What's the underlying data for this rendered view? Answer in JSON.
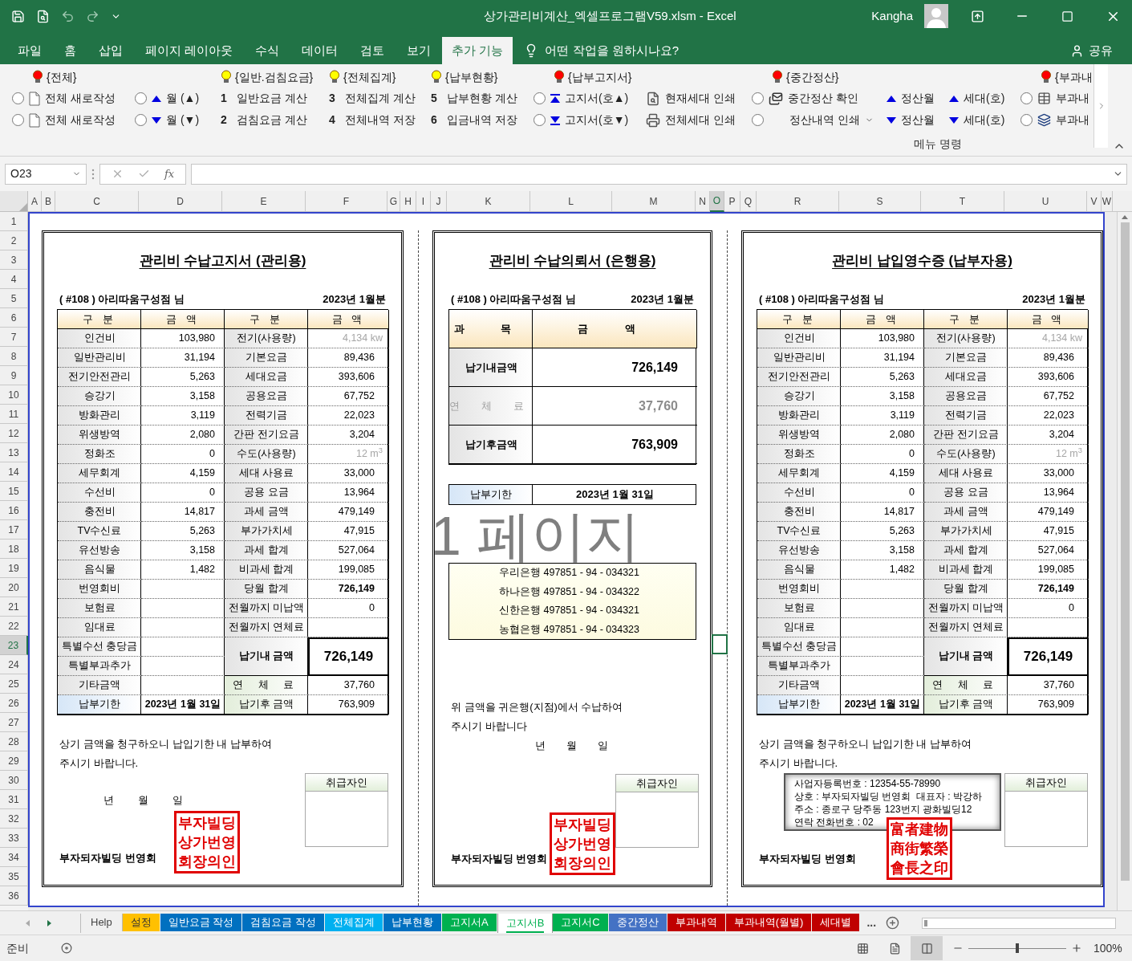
{
  "title_bar": {
    "title": "상가관리비계산_엑셀프로그램V59.xlsm  -  Excel",
    "user": "Kangha"
  },
  "ribbon_tabs": [
    {
      "label": "파일",
      "selected": false
    },
    {
      "label": "홈",
      "selected": false
    },
    {
      "label": "삽입",
      "selected": false
    },
    {
      "label": "페이지 레이아웃",
      "selected": false
    },
    {
      "label": "수식",
      "selected": false
    },
    {
      "label": "데이터",
      "selected": false
    },
    {
      "label": "검토",
      "selected": false
    },
    {
      "label": "보기",
      "selected": false
    },
    {
      "label": "추가 기능",
      "selected": true
    }
  ],
  "tell_me": "어떤 작업을 원하시나요?",
  "share": "공유",
  "ribbon": {
    "columns": [
      {
        "header": {
          "text": "{전체}",
          "color": "#ff0000"
        },
        "items": [
          {
            "selected": false,
            "kind": "doc",
            "text": "전체 새로작성"
          },
          {
            "selected": false,
            "kind": "doc",
            "text": "전체 새로작성"
          }
        ]
      },
      {
        "items": [
          {
            "selected": false,
            "kind": "up",
            "text": "월 (▲)"
          },
          {
            "selected": false,
            "kind": "down",
            "text": "월 (▼)"
          }
        ]
      },
      {
        "header": {
          "text": "{일반.검침요금}",
          "color": "#ffff00"
        },
        "items": [
          {
            "kind": "numbered",
            "number": "1",
            "text": "일반요금 계산"
          },
          {
            "kind": "numbered",
            "number": "2",
            "text": "검침요금 계산"
          }
        ]
      },
      {
        "header": {
          "text": "{전체집계}",
          "color": "#ffff00"
        },
        "items": [
          {
            "kind": "numbered",
            "number": "3",
            "text": "전체집계 계산"
          },
          {
            "kind": "numbered",
            "number": "4",
            "text": "전체내역 저장"
          }
        ]
      },
      {
        "header": {
          "text": "{납부현황}",
          "color": "#ffff00"
        },
        "items": [
          {
            "kind": "numbered",
            "number": "5",
            "text": "납부현황 계산"
          },
          {
            "kind": "numbered",
            "number": "6",
            "text": "입금내역 저장"
          }
        ]
      },
      {
        "header": {
          "text": "{납부고지서}",
          "color": "#ff0000"
        },
        "items": [
          {
            "selected": false,
            "kind": "first",
            "text": "고지서(호▲)"
          },
          {
            "selected": false,
            "kind": "last",
            "text": "고지서(호▼)"
          }
        ]
      },
      {
        "items": [
          {
            "kind": "preview",
            "text": "현재세대 인쇄"
          },
          {
            "kind": "print",
            "text": "전체세대 인쇄"
          }
        ]
      },
      {
        "header": {
          "text": "{중간정산}",
          "color": "#ff0000"
        },
        "items": [
          {
            "selected": false,
            "kind": "mail",
            "text": "중간정산 확인",
            "dropdown": false
          },
          {
            "selected": false,
            "kind": "plain",
            "text": "정산내역 인쇄",
            "dropdown": true
          }
        ]
      },
      {
        "items": [
          {
            "kind": "up",
            "text": "정산월"
          },
          {
            "kind": "down",
            "text": "정산월"
          }
        ]
      },
      {
        "items": [
          {
            "kind": "up",
            "text": "세대(호)"
          },
          {
            "kind": "down",
            "text": "세대(호)"
          }
        ]
      },
      {
        "header": {
          "text": "{부과내",
          "color": "#ff0000"
        },
        "items": [
          {
            "selected": false,
            "kind": "sheet",
            "text": "부과내"
          },
          {
            "selected": false,
            "kind": "windows",
            "text": "부과내"
          }
        ]
      }
    ],
    "group_label": "메뉴 명령"
  },
  "formula_bar": {
    "name_box": "O23",
    "insert_function": "fx"
  },
  "columns": [
    {
      "label": "A",
      "selected": false
    },
    {
      "label": "B",
      "selected": false
    },
    {
      "label": "C",
      "selected": false
    },
    {
      "label": "D",
      "selected": false
    },
    {
      "label": "E",
      "selected": false
    },
    {
      "label": "F",
      "selected": false
    },
    {
      "label": "G",
      "selected": false
    },
    {
      "label": "H",
      "selected": false
    },
    {
      "label": "I",
      "selected": false
    },
    {
      "label": "J",
      "selected": false
    },
    {
      "label": "K",
      "selected": false
    },
    {
      "label": "L",
      "selected": false
    },
    {
      "label": "M",
      "selected": false
    },
    {
      "label": "N",
      "selected": false
    },
    {
      "label": "O",
      "selected": true
    },
    {
      "label": "P",
      "selected": false
    },
    {
      "label": "Q",
      "selected": false
    },
    {
      "label": "R",
      "selected": false
    },
    {
      "label": "S",
      "selected": false
    },
    {
      "label": "T",
      "selected": false
    },
    {
      "label": "U",
      "selected": false
    },
    {
      "label": "V",
      "selected": false
    },
    {
      "label": "W",
      "selected": false
    }
  ],
  "rows": [
    {
      "label": "1",
      "selected": false
    },
    {
      "label": "2",
      "selected": false
    },
    {
      "label": "3",
      "selected": false
    },
    {
      "label": "4",
      "selected": false
    },
    {
      "label": "5",
      "selected": false
    },
    {
      "label": "6",
      "selected": false
    },
    {
      "label": "7",
      "selected": false
    },
    {
      "label": "8",
      "selected": false
    },
    {
      "label": "9",
      "selected": false
    },
    {
      "label": "10",
      "selected": false
    },
    {
      "label": "11",
      "selected": false
    },
    {
      "label": "12",
      "selected": false
    },
    {
      "label": "13",
      "selected": false
    },
    {
      "label": "14",
      "selected": false
    },
    {
      "label": "15",
      "selected": false
    },
    {
      "label": "16",
      "selected": false
    },
    {
      "label": "17",
      "selected": false
    },
    {
      "label": "18",
      "selected": false
    },
    {
      "label": "19",
      "selected": false
    },
    {
      "label": "20",
      "selected": false
    },
    {
      "label": "21",
      "selected": false
    },
    {
      "label": "22",
      "selected": false
    },
    {
      "label": "23",
      "selected": true
    },
    {
      "label": "24",
      "selected": false
    },
    {
      "label": "25",
      "selected": false
    },
    {
      "label": "26",
      "selected": false
    },
    {
      "label": "27",
      "selected": false
    },
    {
      "label": "28",
      "selected": false
    },
    {
      "label": "29",
      "selected": false
    },
    {
      "label": "30",
      "selected": false
    },
    {
      "label": "31",
      "selected": false
    },
    {
      "label": "32",
      "selected": false
    },
    {
      "label": "33",
      "selected": false
    },
    {
      "label": "34",
      "selected": false
    },
    {
      "label": "35",
      "selected": false
    },
    {
      "label": "36",
      "selected": false
    }
  ],
  "panels": [
    {
      "kind": "notice",
      "title": "관리비 수납고지서 (관리용)",
      "customer": "( #108 ) 아리따움구성점 님",
      "period": "2023년 1월분",
      "headers": [
        "구 분",
        "금 액",
        "구 분",
        "금 액"
      ],
      "left_items": [
        {
          "label": "인건비",
          "value": "103,980"
        },
        {
          "label": "일반관리비",
          "value": "31,194"
        },
        {
          "label": "전기안전관리",
          "value": "5,263"
        },
        {
          "label": "승강기",
          "value": "3,158"
        },
        {
          "label": "방화관리",
          "value": "3,119"
        },
        {
          "label": "위생방역",
          "value": "2,080"
        },
        {
          "label": "정화조",
          "value": "0"
        },
        {
          "label": "세무회계",
          "value": "4,159"
        },
        {
          "label": "수선비",
          "value": "0"
        },
        {
          "label": "충전비",
          "value": "14,817"
        },
        {
          "label": "TV수신료",
          "value": "5,263"
        },
        {
          "label": "유선방송",
          "value": "3,158"
        },
        {
          "label": "음식물",
          "value": "1,482"
        },
        {
          "label": "번영회비"
        },
        {
          "label": "보험료"
        },
        {
          "label": "임대료"
        },
        {
          "label": "특별수선 충당금"
        },
        {
          "label": "특별부과추가"
        },
        {
          "label": "기타금액"
        }
      ],
      "right_items": [
        {
          "label": "전기(사용량)",
          "value": "4,134 kw",
          "kind": "usage"
        },
        {
          "label": "기본요금",
          "value": "89,436",
          "kind": "plain"
        },
        {
          "label": "세대요금",
          "value": "393,606",
          "kind": "plain"
        },
        {
          "label": "공용요금",
          "value": "67,752",
          "kind": "plain"
        },
        {
          "label": "전력기금",
          "value": "22,023",
          "kind": "plain"
        },
        {
          "label": "간판 전기요금",
          "value": "3,204",
          "kind": "plain"
        },
        {
          "label": "수도(사용량)",
          "value": "12 m$^{3}$",
          "kind": "usage"
        },
        {
          "label": "세대 사용료",
          "value": "33,000",
          "kind": "plain"
        },
        {
          "label": "공용 요금",
          "value": "13,964",
          "kind": "plain"
        },
        {
          "label": "과세 금액",
          "value": "479,149",
          "kind": "plain"
        },
        {
          "label": "부가가치세",
          "value": "47,915",
          "kind": "plain"
        },
        {
          "label": "과세 합계",
          "value": "527,064",
          "kind": "plain"
        },
        {
          "label": "비과세 합계",
          "value": "199,085",
          "kind": "plain"
        },
        {
          "label": "당월 합계",
          "value": "726,149",
          "kind": "total"
        },
        {
          "label": "전월까지 미납액",
          "value": "0",
          "kind": "plain"
        },
        {
          "label": "전월까지 연체료",
          "kind": "plain"
        }
      ],
      "due_amount": {
        "label": "납기내 금액",
        "value": "726,149"
      },
      "late_fee": {
        "label": "연 체 료",
        "value": "37,760"
      },
      "deadline": {
        "label": "납부기한",
        "value": "2023년 1월 31일"
      },
      "after_amount": {
        "label": "납기후 금액",
        "value": "763,909"
      },
      "message": [
        "상기 금액을 청구하오니 납입기한 내 납부하여",
        "주시기 바랍니다."
      ],
      "date_labels": [
        "년",
        "월",
        "일"
      ],
      "handler_box": "취급자인",
      "stamp": [
        "부자빌딩",
        "상가번영",
        "회장의인"
      ],
      "organization": "부자되자빌딩 번영회"
    },
    {
      "kind": "bank",
      "title": "관리비 수납의뢰서 (은행용)",
      "customer": "( #108 ) 아리따움구성점 님",
      "period": "2023년 1월분",
      "headers": [
        "과 목",
        "금 액"
      ],
      "amounts": [
        {
          "label": "납기내금액",
          "value": "726,149",
          "kind": "strong"
        },
        {
          "label": "연 체 료",
          "value": "37,760",
          "kind": "muted"
        },
        {
          "label": "납기후금액",
          "value": "763,909",
          "kind": "strong"
        }
      ],
      "deadline": {
        "label": "납부기한",
        "value": "2023년 1월 31일"
      },
      "banks": [
        "우리은행 497851 - 94 - 034321",
        "하나은행 497851 - 94 - 034322",
        "신한은행 497851 - 94 - 034321",
        "농협은행 497851 - 94 - 034323"
      ],
      "message": [
        "위 금액을 귀은행(지점)에서 수납하여",
        "주시기 바랍니다"
      ],
      "date_labels": [
        "년",
        "월",
        "일"
      ],
      "handler_box": "취급자인",
      "stamp": [
        "부자빌딩",
        "상가번영",
        "회장의인"
      ],
      "organization": "부자되자빌딩 번영회"
    },
    {
      "kind": "receipt",
      "title": "관리비 납입영수증 (납부자용)",
      "customer": "( #108 ) 아리따움구성점 님",
      "period": "2023년 1월분",
      "headers": [
        "구 분",
        "금 액",
        "구 분",
        "금 액"
      ],
      "left_items": [
        {
          "label": "인건비",
          "value": "103,980"
        },
        {
          "label": "일반관리비",
          "value": "31,194"
        },
        {
          "label": "전기안전관리",
          "value": "5,263"
        },
        {
          "label": "승강기",
          "value": "3,158"
        },
        {
          "label": "방화관리",
          "value": "3,119"
        },
        {
          "label": "위생방역",
          "value": "2,080"
        },
        {
          "label": "정화조",
          "value": "0"
        },
        {
          "label": "세무회계",
          "value": "4,159"
        },
        {
          "label": "수선비",
          "value": "0"
        },
        {
          "label": "충전비",
          "value": "14,817"
        },
        {
          "label": "TV수신료",
          "value": "5,263"
        },
        {
          "label": "유선방송",
          "value": "3,158"
        },
        {
          "label": "음식물",
          "value": "1,482"
        },
        {
          "label": "번영회비"
        },
        {
          "label": "보험료"
        },
        {
          "label": "임대료"
        },
        {
          "label": "특별수선 충당금"
        },
        {
          "label": "특별부과추가"
        },
        {
          "label": "기타금액"
        }
      ],
      "right_items": [
        {
          "label": "전기(사용량)",
          "value": "4,134 kw",
          "kind": "usage"
        },
        {
          "label": "기본요금",
          "value": "89,436",
          "kind": "plain"
        },
        {
          "label": "세대요금",
          "value": "393,606",
          "kind": "plain"
        },
        {
          "label": "공용요금",
          "value": "67,752",
          "kind": "plain"
        },
        {
          "label": "전력기금",
          "value": "22,023",
          "kind": "plain"
        },
        {
          "label": "간판 전기요금",
          "value": "3,204",
          "kind": "plain"
        },
        {
          "label": "수도(사용량)",
          "value": "12 m$^{3}$",
          "kind": "usage"
        },
        {
          "label": "세대 사용료",
          "value": "33,000",
          "kind": "plain"
        },
        {
          "label": "공용 요금",
          "value": "13,964",
          "kind": "plain"
        },
        {
          "label": "과세 금액",
          "value": "479,149",
          "kind": "plain"
        },
        {
          "label": "부가가치세",
          "value": "47,915",
          "kind": "plain"
        },
        {
          "label": "과세 합계",
          "value": "527,064",
          "kind": "plain"
        },
        {
          "label": "비과세 합계",
          "value": "199,085",
          "kind": "plain"
        },
        {
          "label": "당월 합계",
          "value": "726,149",
          "kind": "total"
        },
        {
          "label": "전월까지 미납액",
          "value": "0",
          "kind": "plain"
        },
        {
          "label": "전월까지 연체료",
          "kind": "plain"
        }
      ],
      "due_amount": {
        "label": "납기내 금액",
        "value": "726,149"
      },
      "late_fee": {
        "label": "연 체 료",
        "value": "37,760"
      },
      "deadline": {
        "label": "납부기한",
        "value": "2023년 1월 31일"
      },
      "after_amount": {
        "label": "납기후 금액",
        "value": "763,909"
      },
      "message": [
        "상기 금액을 청구하오니 납입기한 내 납부하여",
        "주시기 바랍니다."
      ],
      "business_info": [
        "사업자등록번호 : 12354-55-78990",
        "상호 : 부자되자빌딩 번영회  대표자 : 박강하",
        "주소 : 종로구 당주동 123번지 광화빌딩12",
        "연락 전화번호 : 02"
      ],
      "handler_box": "취급자인",
      "stamp": [
        "富者建物",
        "商街繁榮",
        "會長之印"
      ],
      "organization": "부자되자빌딩 번영회"
    }
  ],
  "watermark": "1 페이지",
  "sheet_tabs": [
    {
      "label": "Help",
      "selected": false
    },
    {
      "label": "설정",
      "color": "#ffc000",
      "selected": false
    },
    {
      "label": "일반요금 작성",
      "color": "#0070c0",
      "selected": false
    },
    {
      "label": "검침요금 작성",
      "color": "#0070c0",
      "selected": false
    },
    {
      "label": "전체집계",
      "color": "#00b0f0",
      "selected": false
    },
    {
      "label": "납부현황",
      "color": "#0070c0",
      "selected": false
    },
    {
      "label": "고지서A",
      "color": "#00b050",
      "selected": false
    },
    {
      "label": "고지서B",
      "color": "#00b050",
      "selected": true
    },
    {
      "label": "고지서C",
      "color": "#00b050",
      "selected": false
    },
    {
      "label": "중간정산",
      "color": "#4472c4",
      "selected": false
    },
    {
      "label": "부과내역",
      "color": "#c00000",
      "selected": false
    },
    {
      "label": "부과내역(월별)",
      "color": "#c00000",
      "selected": false
    },
    {
      "label": "세대별",
      "color": "#c00000",
      "selected": false
    }
  ],
  "more_tabs": "...",
  "status_bar": {
    "status": "준비",
    "views": [
      {
        "kind": "normal",
        "selected": false
      },
      {
        "kind": "layout",
        "selected": false
      },
      {
        "kind": "break",
        "selected": true
      }
    ],
    "zoom": {
      "level": 0.5,
      "reading": "100%"
    }
  }
}
